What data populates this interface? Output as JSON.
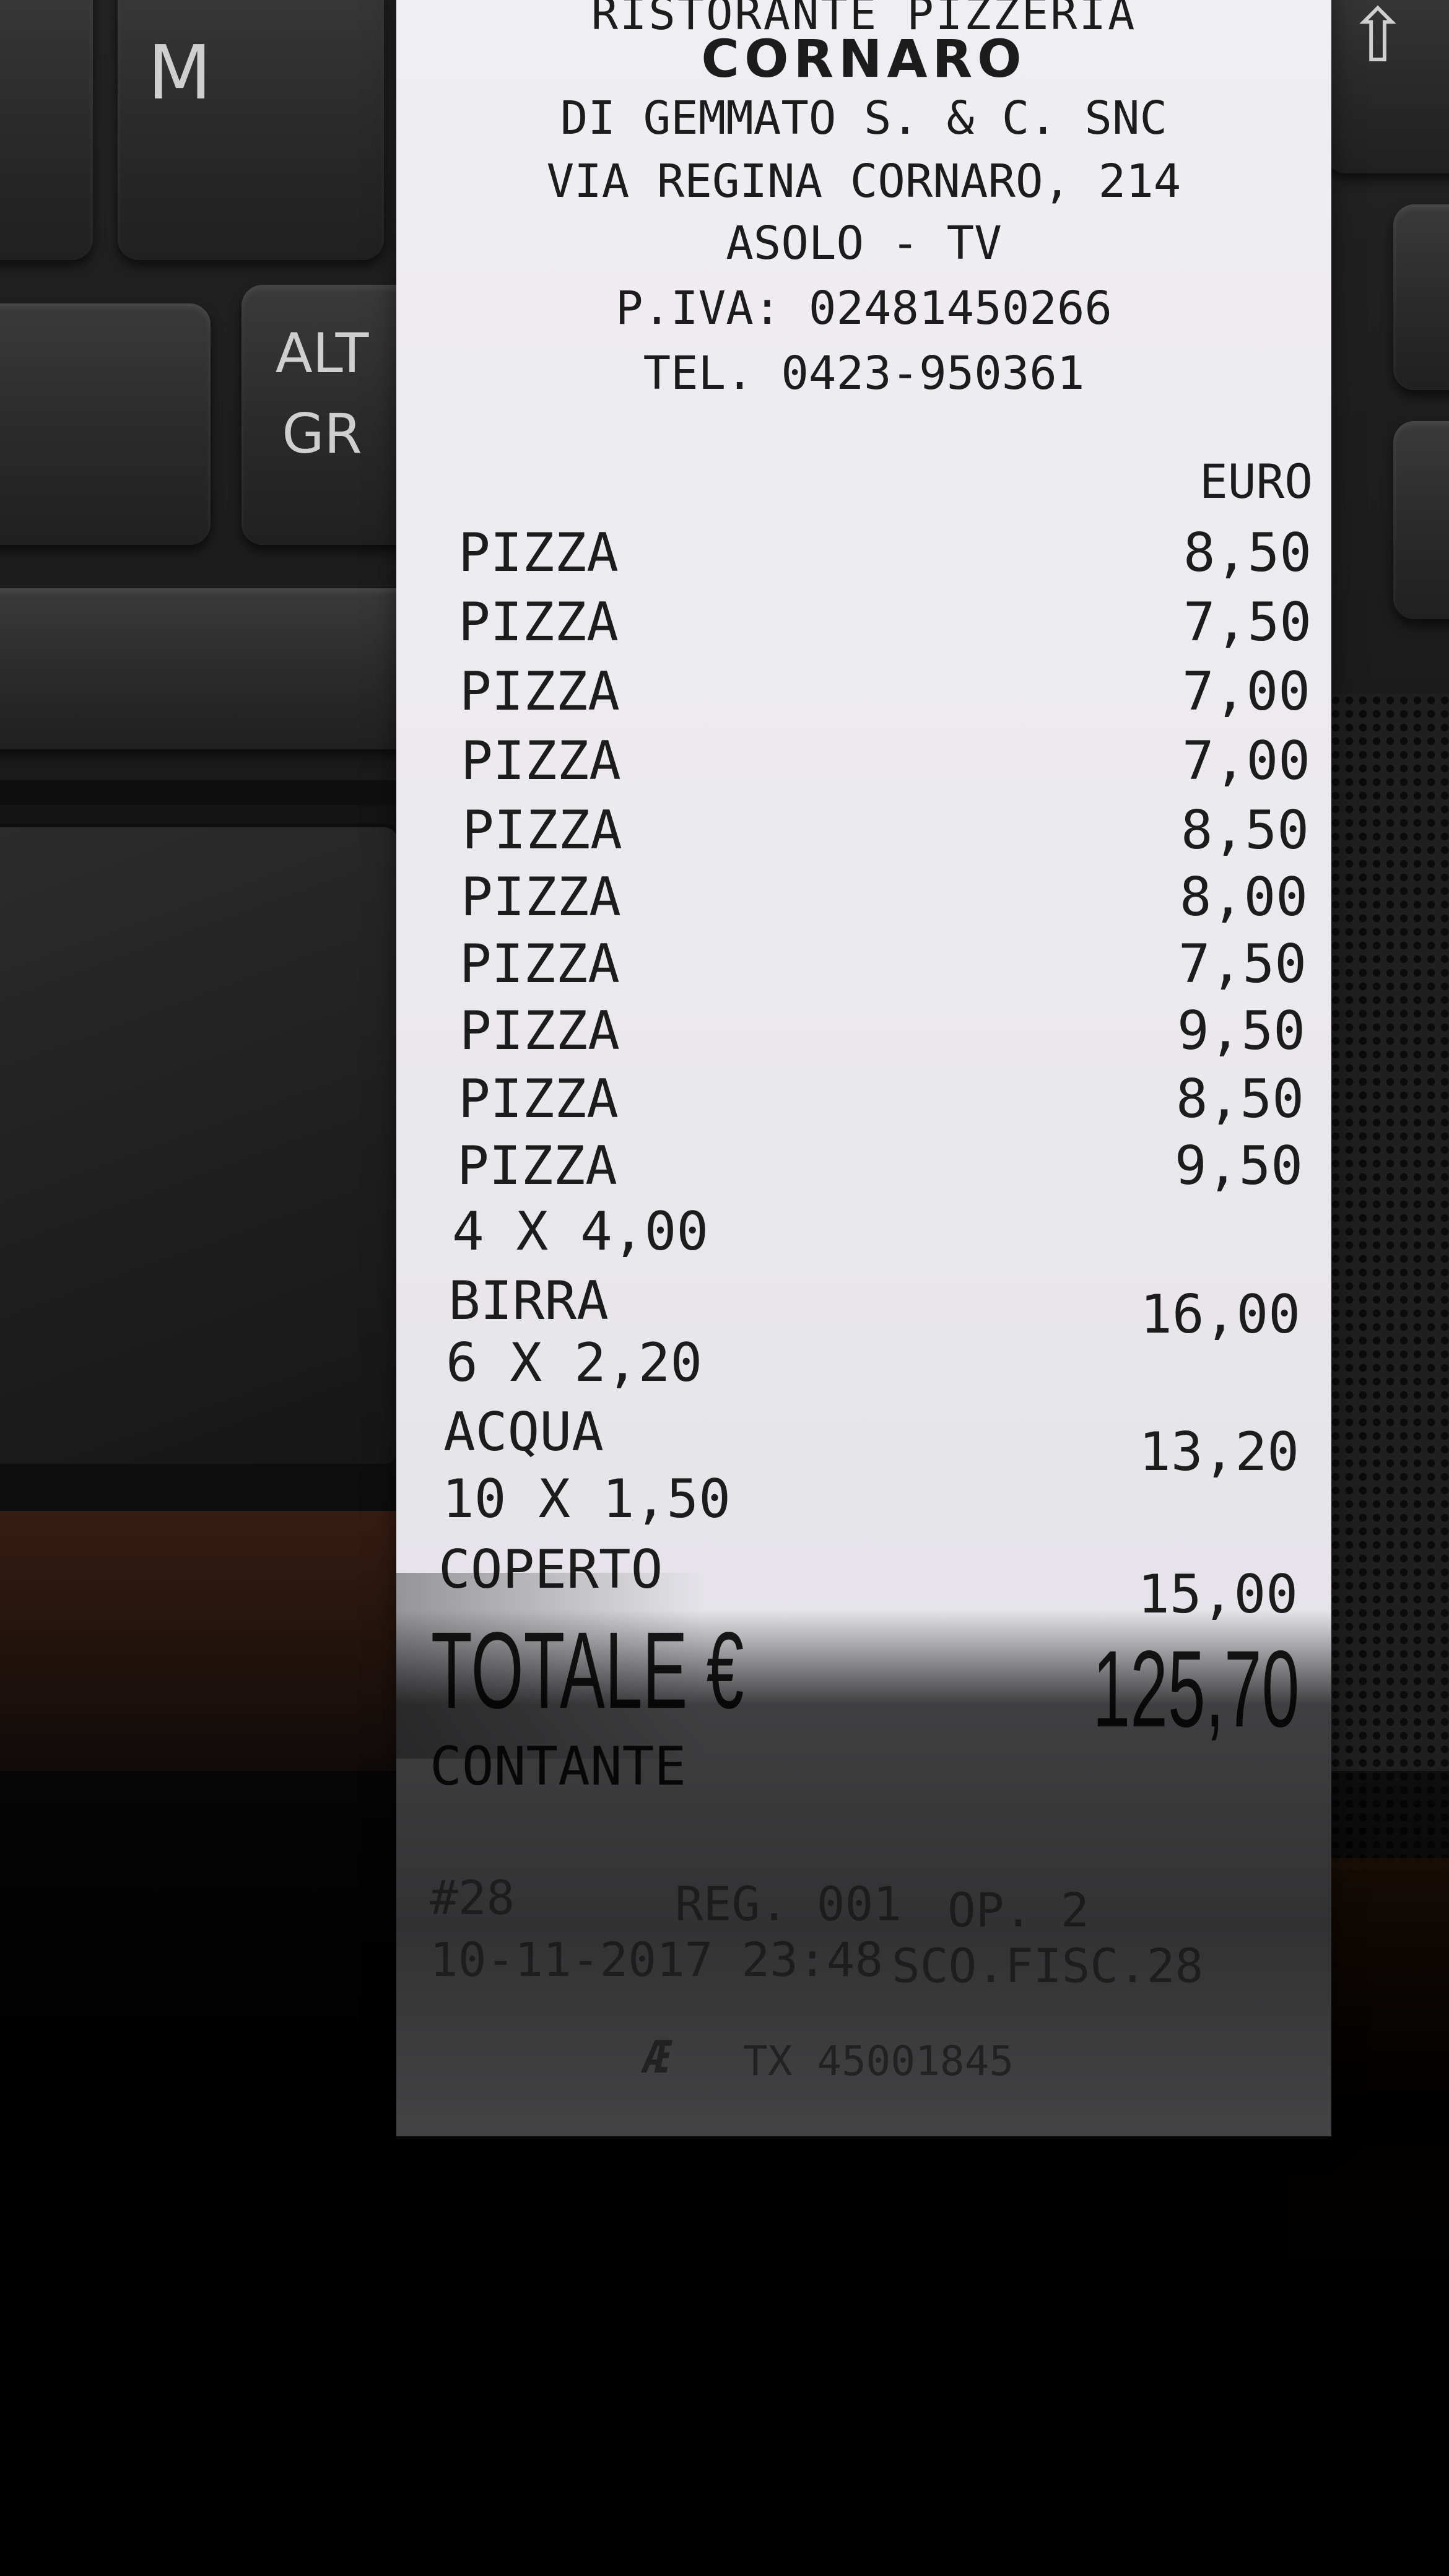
{
  "keyboard": {
    "key_m": "M",
    "key_altgr_line1": "ALT",
    "key_altgr_line2": "GR",
    "arrow_key_symbol": "⇧"
  },
  "receipt": {
    "header": {
      "line1": "RISTORANTE PIZZERIA",
      "business_name": "CORNARO",
      "company": "DI GEMMATO S. & C. SNC",
      "address": "VIA REGINA CORNARO, 214",
      "city": "ASOLO - TV",
      "vat": "P.IVA: 02481450266",
      "phone": "TEL. 0423-950361"
    },
    "currency_label": "EURO",
    "items": [
      {
        "name": "PIZZA",
        "price": "8,50"
      },
      {
        "name": "PIZZA",
        "price": "7,50"
      },
      {
        "name": "PIZZA",
        "price": "7,00"
      },
      {
        "name": "PIZZA",
        "price": "7,00"
      },
      {
        "name": "PIZZA",
        "price": "8,50"
      },
      {
        "name": "PIZZA",
        "price": "8,00"
      },
      {
        "name": "PIZZA",
        "price": "7,50"
      },
      {
        "name": "PIZZA",
        "price": "9,50"
      },
      {
        "name": "PIZZA",
        "price": "8,50"
      },
      {
        "name": "PIZZA",
        "price": "9,50"
      },
      {
        "qty": "4 X 4,00",
        "name": "BIRRA",
        "price": "16,00"
      },
      {
        "qty": "6 X 2,20",
        "name": "ACQUA",
        "price": "13,20"
      },
      {
        "qty": "10 X 1,50",
        "name": "COPERTO",
        "price": "15,00"
      }
    ],
    "total_label": "TOTALE €",
    "total_value": "125,70",
    "payment_method": "CONTANTE",
    "footer": {
      "receipt_number": "#28",
      "register": "REG. 001",
      "operator": "OP. 2",
      "datetime": "10-11-2017 23:48",
      "fiscal": "SCO.FISC.28",
      "fiscal_code": "TX 45001845"
    }
  }
}
